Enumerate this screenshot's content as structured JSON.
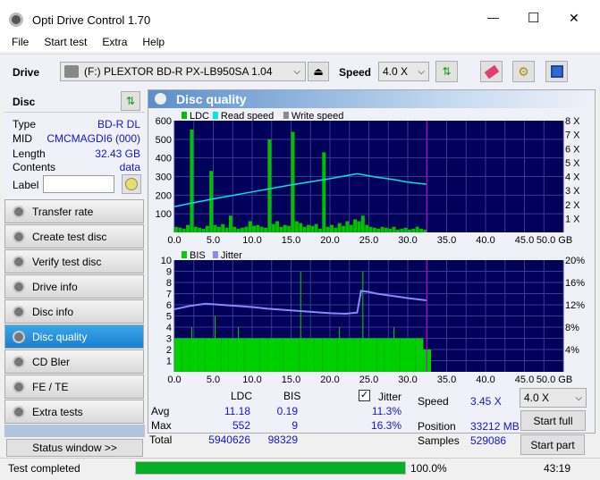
{
  "window": {
    "title": "Opti Drive Control 1.70",
    "minimize": "—",
    "maximize": "☐",
    "close": "✕"
  },
  "menu": [
    "File",
    "Start test",
    "Extra",
    "Help"
  ],
  "toolbar": {
    "drive_label": "Drive",
    "drive_value": "(F:)   PLEXTOR BD-R  PX-LB950SA 1.04",
    "speed_label": "Speed",
    "speed_value": "4.0 X"
  },
  "disc": {
    "header": "Disc",
    "type_label": "Type",
    "type": "BD-R DL",
    "mid_label": "MID",
    "mid": "CMCMAGDI6 (000)",
    "length_label": "Length",
    "length": "32.43 GB",
    "contents_label": "Contents",
    "contents": "data",
    "label_label": "Label",
    "label_value": ""
  },
  "nav": [
    {
      "label": "Transfer rate"
    },
    {
      "label": "Create test disc"
    },
    {
      "label": "Verify test disc"
    },
    {
      "label": "Drive info"
    },
    {
      "label": "Disc info"
    },
    {
      "label": "Disc quality",
      "active": true
    },
    {
      "label": "CD Bler"
    },
    {
      "label": "FE / TE"
    },
    {
      "label": "Extra tests"
    }
  ],
  "status_window": "Status window >>",
  "panel_title": "Disc quality",
  "colors": {
    "plot_bg": "#00005a",
    "ldc": "#00c000",
    "bis": "#00d000",
    "read_speed": "#00e5e5",
    "jitter": "#8888ff",
    "marker": "#c000c0",
    "progress": "#06b025"
  },
  "chart_data": [
    {
      "type": "line",
      "legend": [
        "LDC",
        "Read speed",
        "Write speed"
      ],
      "xlim": [
        0,
        50
      ],
      "ylim": [
        0,
        600
      ],
      "y2lim": [
        0,
        8
      ],
      "xticks": [
        "0.0",
        "5.0",
        "10.0",
        "15.0",
        "20.0",
        "25.0",
        "30.0",
        "35.0",
        "40.0",
        "45.0",
        "50.0 GB"
      ],
      "yticks": [
        "100",
        "200",
        "300",
        "400",
        "500",
        "600"
      ],
      "y2ticks": [
        "1 X",
        "2 X",
        "3 X",
        "4 X",
        "5 X",
        "6 X",
        "7 X",
        "8 X"
      ],
      "disc_end_gb": 32.43,
      "ldc_x": [
        0,
        0.5,
        1,
        1.5,
        2,
        2.5,
        3,
        3.5,
        4,
        4.5,
        5,
        5.5,
        6,
        6.5,
        7,
        7.5,
        8,
        8.5,
        9,
        9.5,
        10,
        10.5,
        11,
        11.5,
        12,
        12.5,
        13,
        13.5,
        14,
        14.5,
        15,
        15.5,
        16,
        16.5,
        17,
        17.5,
        18,
        18.5,
        19,
        19.5,
        20,
        20.5,
        21,
        21.5,
        22,
        22.5,
        23,
        23.5,
        24,
        24.5,
        25,
        25.5,
        26,
        26.5,
        27,
        27.5,
        28,
        28.5,
        29,
        29.5,
        30,
        30.5,
        31,
        31.5,
        32
      ],
      "ldc": [
        30,
        25,
        20,
        40,
        552,
        30,
        25,
        20,
        35,
        330,
        40,
        30,
        45,
        25,
        90,
        30,
        20,
        25,
        30,
        60,
        35,
        40,
        30,
        25,
        500,
        45,
        60,
        30,
        40,
        35,
        540,
        60,
        50,
        30,
        40,
        35,
        45,
        20,
        430,
        30,
        40,
        25,
        50,
        35,
        60,
        40,
        70,
        60,
        90,
        40,
        30,
        25,
        20,
        30,
        25,
        20,
        30,
        15,
        20,
        25,
        15,
        20,
        30,
        20,
        15
      ],
      "read_speed_x": [
        0,
        5,
        10,
        15,
        20,
        23.5,
        26,
        28,
        30,
        32.4
      ],
      "read_speed": [
        1.85,
        2.4,
        2.9,
        3.4,
        3.85,
        4.2,
        3.95,
        3.8,
        3.6,
        3.45
      ]
    },
    {
      "type": "bar+line",
      "legend": [
        "BIS",
        "Jitter"
      ],
      "xlim": [
        0,
        50
      ],
      "ylim": [
        0,
        10
      ],
      "y2lim": [
        0,
        20
      ],
      "xticks": [
        "0.0",
        "5.0",
        "10.0",
        "15.0",
        "20.0",
        "25.0",
        "30.0",
        "35.0",
        "40.0",
        "45.0",
        "50.0 GB"
      ],
      "yticks": [
        "1",
        "2",
        "3",
        "4",
        "5",
        "6",
        "7",
        "8",
        "9",
        "10"
      ],
      "y2ticks": [
        "4%",
        "8%",
        "12%",
        "16%",
        "20%"
      ],
      "bis_x": [
        0,
        1,
        2,
        3,
        4,
        5,
        6,
        7,
        8,
        9,
        10,
        11,
        12,
        13,
        14,
        15,
        16,
        17,
        18,
        19,
        20,
        21,
        22,
        23,
        24,
        25,
        26,
        27,
        28,
        29,
        30,
        31,
        32
      ],
      "bis": [
        3,
        3,
        4,
        3,
        3,
        5,
        3,
        3,
        4,
        3,
        3,
        3,
        3,
        3,
        3,
        3,
        9,
        3,
        3,
        3,
        3,
        4,
        3,
        3,
        9,
        3,
        3,
        3,
        4,
        3,
        3,
        3,
        2
      ],
      "jitter_x": [
        0,
        2,
        4,
        6,
        8,
        10,
        12,
        14,
        16,
        18,
        20,
        22,
        23.5,
        24,
        25,
        26,
        28,
        30,
        32.4
      ],
      "jitter": [
        11.2,
        11.8,
        12.2,
        12.0,
        11.8,
        11.6,
        11.3,
        11.1,
        10.9,
        10.7,
        10.5,
        10.4,
        10.6,
        14.5,
        14.3,
        14.0,
        13.6,
        13.2,
        12.8
      ]
    }
  ],
  "stats": {
    "col_ldc": "LDC",
    "col_bis": "BIS",
    "col_jitter": "Jitter",
    "jitter_checked": true,
    "avg_label": "Avg",
    "max_label": "Max",
    "total_label": "Total",
    "ldc_avg": "11.18",
    "ldc_max": "552",
    "ldc_total": "5940626",
    "bis_avg": "0.19",
    "bis_max": "9",
    "bis_total": "98329",
    "jitter_avg": "11.3%",
    "jitter_max": "16.3%",
    "speed_label": "Speed",
    "speed": "3.45 X",
    "position_label": "Position",
    "position": "33212 MB",
    "samples_label": "Samples",
    "samples": "529086",
    "speed_select": "4.0 X",
    "start_full": "Start full",
    "start_part": "Start part"
  },
  "status": {
    "text": "Test completed",
    "progress": 100,
    "progress_text": "100.0%",
    "time": "43:19"
  }
}
